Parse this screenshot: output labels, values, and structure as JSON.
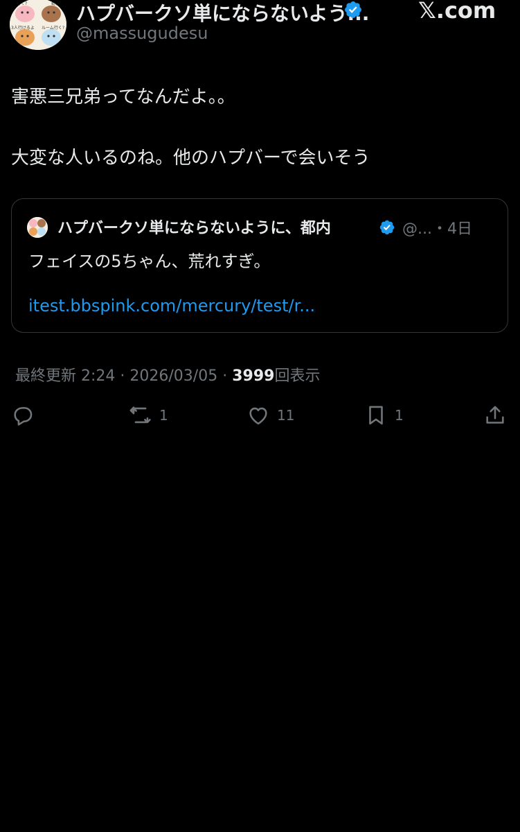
{
  "author": {
    "display_name": "ハプバークソ単にならないよう...",
    "handle": "@massugudesu",
    "avatar_labels": [
      "初行く?",
      "乾杯",
      "3人行けるよ",
      "ルーム行く?"
    ]
  },
  "brand": "𝕏.com",
  "tweet": {
    "lines": [
      "害悪三兄弟ってなんだよ。。",
      "大変な人いるのね。他のハプバーで会いそう"
    ]
  },
  "quote": {
    "display_name": "ハプバークソ単にならないように、都内",
    "meta": "@...・4日",
    "text": "フェイスの5ちゃん、荒れすぎ。",
    "link": "itest.bbspink.com/mercury/test/r..."
  },
  "meta": {
    "updated_label": "最終更新 2:24",
    "separator": "·",
    "date": "2026/03/05",
    "views_count": "3999",
    "views_label": "回表示"
  },
  "actions": {
    "reply_count": "",
    "retweet_count": "1",
    "like_count": "11",
    "bookmark_count": "1"
  },
  "colors": {
    "background": "#000000",
    "text": "#e7e9ea",
    "secondary": "#71767b",
    "link": "#1d9bf0",
    "verified": "#1d9bf0",
    "border": "#333639"
  }
}
